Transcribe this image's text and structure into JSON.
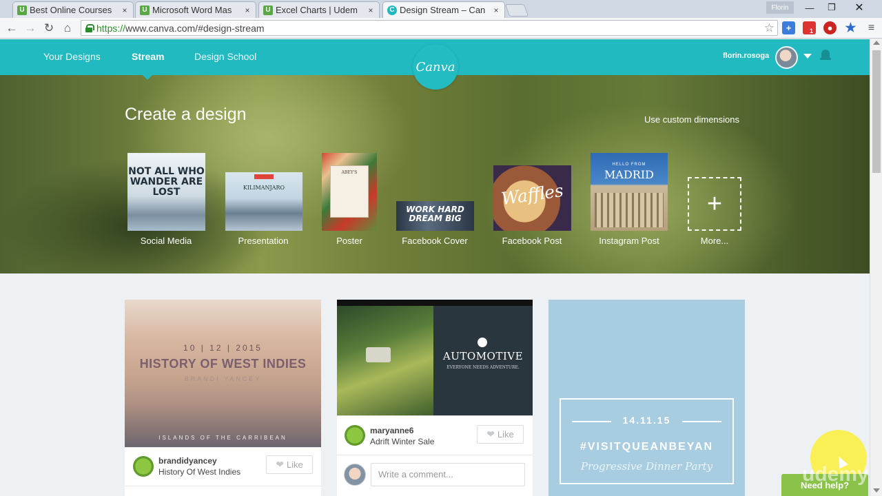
{
  "browser": {
    "tabs": [
      {
        "label": "Best Online Courses",
        "fav": "U",
        "close": "×"
      },
      {
        "label": "Microsoft Word Mas",
        "fav": "U",
        "close": "×"
      },
      {
        "label": "Excel Charts | Udem",
        "fav": "U",
        "close": "×"
      },
      {
        "label": "Design Stream – Can",
        "fav": "C",
        "close": "×"
      }
    ],
    "window_user": "Florin",
    "address": {
      "scheme": "https://",
      "rest": "www.canva.com/#design-stream"
    },
    "ext_badge": "1"
  },
  "nav": {
    "items": [
      "Your Designs",
      "Stream",
      "Design School"
    ],
    "logo": "Canva",
    "username": "florin.rosoga"
  },
  "hero": {
    "title": "Create a design",
    "custom_link": "Use custom dimensions",
    "types": [
      {
        "label": "Social Media",
        "thumb_text": "NOT ALL WHO WANDER ARE LOST"
      },
      {
        "label": "Presentation",
        "thumb_text": "KILIMANJARO"
      },
      {
        "label": "Poster",
        "thumb_text": "ABEY'S"
      },
      {
        "label": "Facebook Cover",
        "thumb_text": "WORK HARD DREAM BIG"
      },
      {
        "label": "Facebook Post",
        "thumb_text": "Waffles"
      },
      {
        "label": "Instagram Post",
        "thumb_small": "HELLO FROM",
        "thumb_text": "MADRID"
      },
      {
        "label": "More...",
        "thumb_text": "+"
      }
    ]
  },
  "stream": {
    "card1": {
      "date": "10 | 12 | 2015",
      "title": "HISTORY OF WEST INDIES",
      "subtitle": "BRANDI YANCEY",
      "footer": "ISLANDS OF THE CARRIBEAN",
      "user": "brandidyancey",
      "design": "History Of West Indies",
      "like": "Like"
    },
    "card2": {
      "title": "AUTOMOTIVE",
      "subtitle": "EVERYONE NEEDS ADVENTURE.",
      "user": "maryanne6",
      "design": "Adrift Winter Sale",
      "like": "Like",
      "comment_placeholder": "Write a comment..."
    },
    "card3": {
      "date": "14.11.15",
      "hashtag": "#VISITQUEANBEYAN",
      "subtitle": "Progressive Dinner Party"
    }
  },
  "help": {
    "label": "Need help?",
    "watermark": "udemy"
  },
  "colors": {
    "canva_teal": "#20bac0",
    "help_green": "#8bc34a"
  }
}
